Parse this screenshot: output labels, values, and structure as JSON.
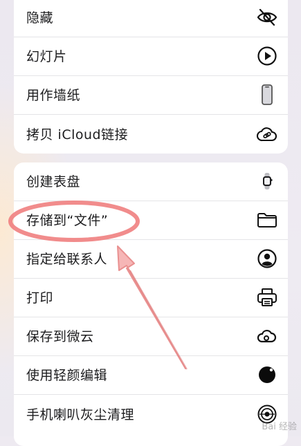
{
  "menu": {
    "group1": [
      {
        "label": "隐藏",
        "icon": "eye-slash-icon"
      },
      {
        "label": "幻灯片",
        "icon": "play-circle-icon"
      },
      {
        "label": "用作墙纸",
        "icon": "phone-icon"
      },
      {
        "label": "拷贝 iCloud链接",
        "icon": "icloud-link-icon"
      }
    ],
    "group2": [
      {
        "label": "创建表盘",
        "icon": "watch-icon"
      },
      {
        "label": "存储到“文件”",
        "icon": "folder-icon"
      },
      {
        "label": "指定给联系人",
        "icon": "person-circle-icon"
      },
      {
        "label": "打印",
        "icon": "printer-icon"
      },
      {
        "label": "保存到微云",
        "icon": "weiyun-cloud-icon"
      },
      {
        "label": "使用轻颜编辑",
        "icon": "qingyan-dot-icon"
      },
      {
        "label": "手机喇叭灰尘清理",
        "icon": "speaker-clean-icon"
      }
    ]
  },
  "annotation": {
    "highlight_color": "#f08080",
    "arrow_color": "#f4a0a0"
  },
  "watermark": {
    "text": "Bai 经验"
  }
}
